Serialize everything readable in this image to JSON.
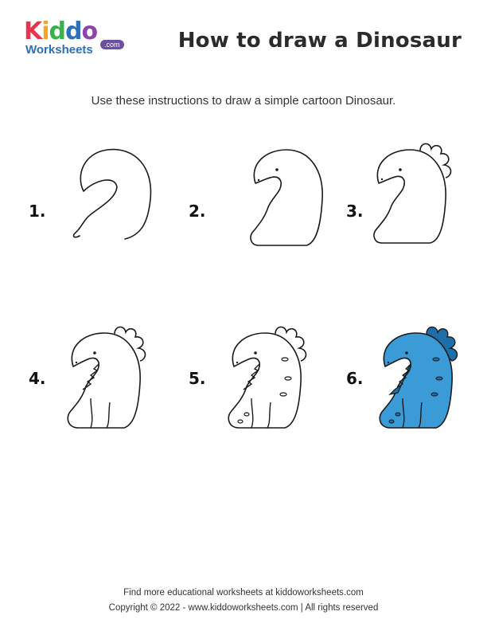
{
  "logo": {
    "letters": [
      {
        "char": "K",
        "color": "#e8344e"
      },
      {
        "char": "i",
        "color": "#f5a623"
      },
      {
        "char": "d",
        "color": "#37b34a"
      },
      {
        "char": "d",
        "color": "#2e6fb8"
      },
      {
        "char": "o",
        "color": "#8e44ad"
      }
    ],
    "worksheets": "Worksheets",
    "dotcom": ".com"
  },
  "title": "How to draw a Dinosaur",
  "subtitle": "Use these instructions to draw a simple cartoon Dinosaur.",
  "steps": [
    {
      "label": "1."
    },
    {
      "label": "2."
    },
    {
      "label": "3."
    },
    {
      "label": "4."
    },
    {
      "label": "5."
    },
    {
      "label": "6."
    }
  ],
  "colors": {
    "dino_fill": "#3a9bd6",
    "dino_dark": "#1c6fa8",
    "outline": "#1a1a1a"
  },
  "footer": {
    "line1": "Find more educational worksheets at kiddoworksheets.com",
    "line2": "Copyright © 2022 - www.kiddoworksheets.com  |  All rights reserved"
  }
}
